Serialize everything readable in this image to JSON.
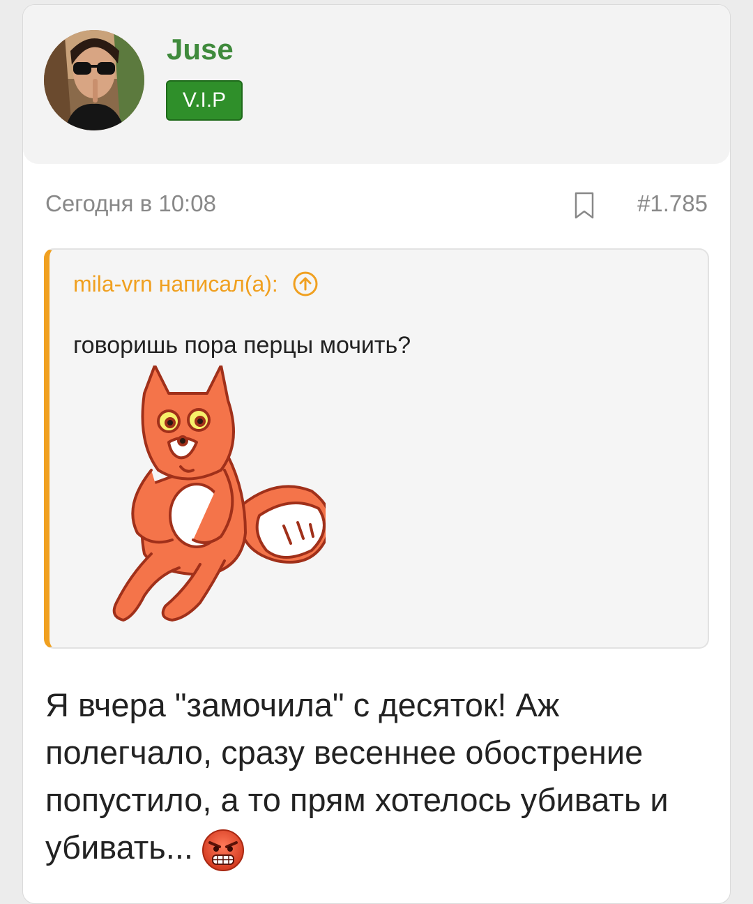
{
  "author": {
    "name": "Juse",
    "badge": "V.I.P",
    "avatar_icon": "user-avatar-photo"
  },
  "post": {
    "date": "Сегодня в 10:08",
    "number": "#1.785",
    "bookmark_icon": "bookmark-icon"
  },
  "quote": {
    "header": "mila-vrn написал(а):",
    "jump_icon": "arrow-up-circle-icon",
    "text": "говоришь пора перцы мочить?",
    "sticker_icon": "fox-sticker"
  },
  "reply": {
    "text": "Я вчера \"замочила\" с десяток! Аж полегчало, сразу весеннее обострение попустило, а то прям хотелось убивать и убивать...",
    "emoji_icon": "angry-face-emoji"
  },
  "colors": {
    "author_name": "#3f8a3c",
    "vip_badge": "#2f8f2a",
    "quote_accent": "#f0a020",
    "meta_text": "#888888"
  }
}
